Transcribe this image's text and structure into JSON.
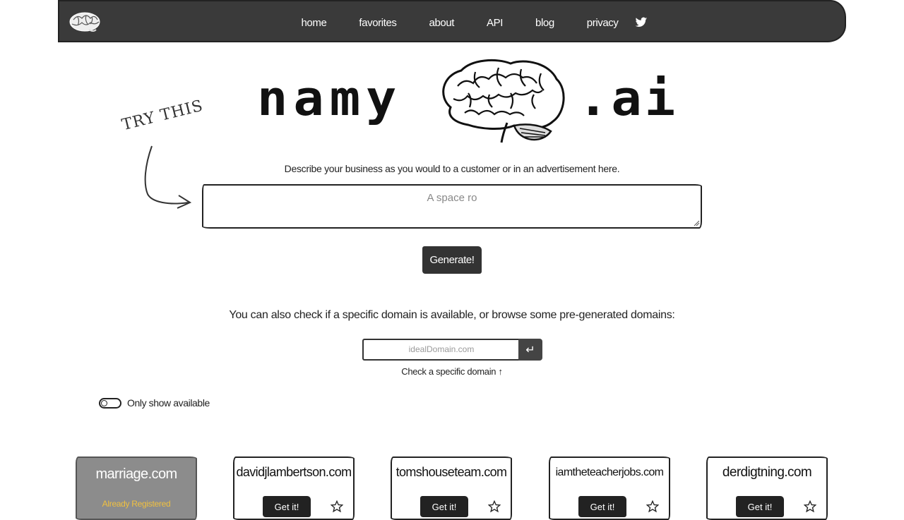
{
  "nav": {
    "links": [
      "home",
      "favorites",
      "about",
      "API",
      "blog",
      "privacy"
    ]
  },
  "hero": {
    "left_text": "namy",
    "right_text": ".ai"
  },
  "try_this": "TRY THIS",
  "describe": {
    "label": "Describe your business as you would to a customer or in an advertisement here.",
    "value": "A space ro"
  },
  "generate_label": "Generate!",
  "check": {
    "label": "You can also check if a specific domain is available, or browse some pre-generated domains:",
    "placeholder": "idealDomain.com",
    "enter_glyph": "↵",
    "hint": "Check a specific domain",
    "hint_arrow": "↑"
  },
  "toggle": {
    "label": "Only show available",
    "checked": false
  },
  "cards": [
    {
      "domain": "marriage.com",
      "status": "Already Registered",
      "registered": true
    },
    {
      "domain": "davidjlambertson.com",
      "action": "Get it!",
      "registered": false
    },
    {
      "domain": "tomshouseteam.com",
      "action": "Get it!",
      "registered": false
    },
    {
      "domain": "iamtheteacherjobs.com",
      "action": "Get it!",
      "registered": false
    },
    {
      "domain": "derdigtning.com",
      "action": "Get it!",
      "registered": false
    }
  ],
  "colors": {
    "navbar": "#3a3a3a",
    "button": "#333333",
    "registered_card": "#8c8c8c",
    "registered_text": "#f0c040"
  }
}
